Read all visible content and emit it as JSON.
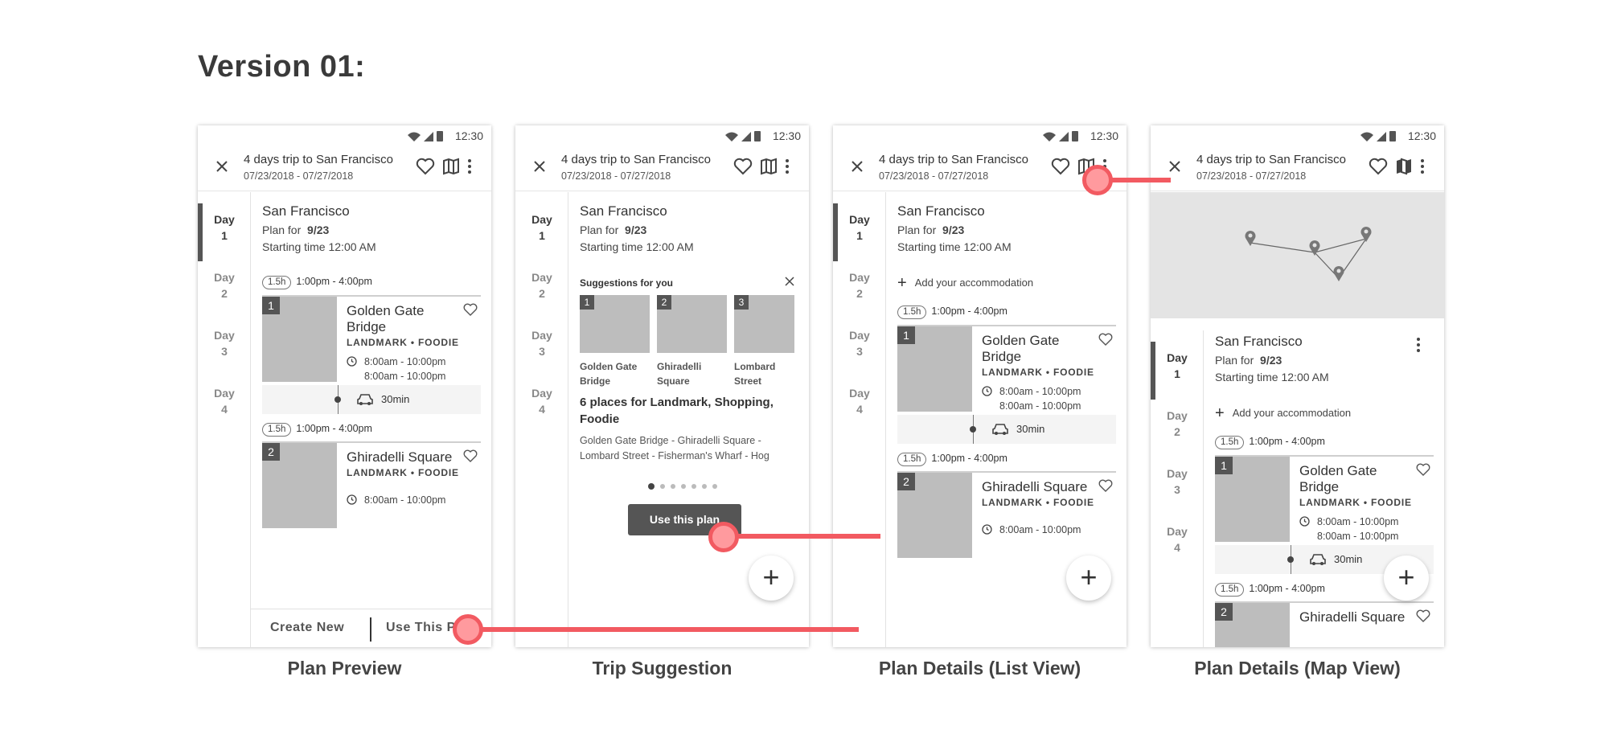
{
  "heading": "Version 01:",
  "status_time": "12:30",
  "trip": {
    "title": "4 days trip to San Francisco",
    "dates": "07/23/2018 - 07/27/2018"
  },
  "days": [
    {
      "label": "Day",
      "num": "1"
    },
    {
      "label": "Day",
      "num": "2"
    },
    {
      "label": "Day",
      "num": "3"
    },
    {
      "label": "Day",
      "num": "4"
    }
  ],
  "plan": {
    "city": "San Francisco",
    "plan_for_prefix": "Plan for",
    "plan_for_date": "9/23",
    "start_time": "Starting time 12:00 AM",
    "add_accommodation": "Add your accommodation"
  },
  "stops": [
    {
      "num": "1",
      "duration": "1.5h",
      "slot": "1:00pm - 4:00pm",
      "name": "Golden Gate Bridge",
      "tags": "LANDMARK • FOODIE",
      "hours": [
        "8:00am - 10:00pm",
        "8:00am - 10:00pm"
      ]
    },
    {
      "num": "2",
      "duration": "1.5h",
      "slot": "1:00pm - 4:00pm",
      "name": "Ghiradelli Square",
      "tags": "LANDMARK • FOODIE",
      "hours": [
        "8:00am - 10:00pm"
      ]
    }
  ],
  "transit": "30min",
  "bottom": {
    "create_new": "Create New",
    "use_plan": "Use This Plan"
  },
  "suggestions": {
    "heading": "Suggestions for you",
    "items": [
      {
        "num": "1",
        "name": "Golden Gate Bridge"
      },
      {
        "num": "2",
        "name": "Ghiradelli Square"
      },
      {
        "num": "3",
        "name": "Lombard Street"
      }
    ],
    "title": "6 places for Landmark, Shopping, Foodie",
    "desc": "Golden Gate Bridge - Ghiradelli Square - Lombard Street - Fisherman's Wharf - Hog",
    "button": "Use this plan",
    "active_page": 1,
    "page_count": 7
  },
  "fab": "+",
  "screen_labels": [
    "Plan Preview",
    "Trip Suggestion",
    "Plan Details (List View)",
    "Plan Details (Map View)"
  ],
  "icons": [
    "close-icon",
    "heart-icon",
    "map-icon",
    "more-vert-icon",
    "wifi-icon",
    "signal-icon",
    "battery-icon",
    "clock-icon",
    "car-icon",
    "map-pin-icon",
    "plus-icon"
  ],
  "colors": {
    "hotspot": "#f25a61",
    "placeholder": "#bdbdbd",
    "dark": "#555555"
  }
}
